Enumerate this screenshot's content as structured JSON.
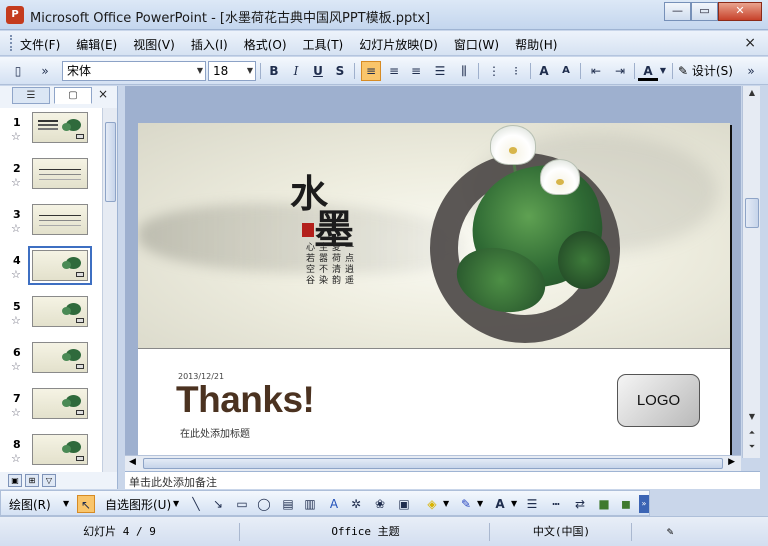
{
  "window": {
    "app_icon": "P",
    "title": "Microsoft Office PowerPoint - [水墨荷花古典中国风PPT模板.pptx]",
    "minimize": "—",
    "restore": "▭",
    "close": "✕"
  },
  "menu": {
    "items": [
      "文件(F)",
      "编辑(E)",
      "视图(V)",
      "插入(I)",
      "格式(O)",
      "工具(T)",
      "幻灯片放映(D)",
      "窗口(W)",
      "帮助(H)"
    ],
    "close": "×"
  },
  "toolbar": {
    "font_name": "宋体",
    "font_size": "18",
    "bold": "B",
    "italic": "I",
    "underline": "U",
    "shadow": "S",
    "design_label": "设计(S)"
  },
  "left_pane": {
    "close": "×",
    "slides": [
      {
        "number": "1"
      },
      {
        "number": "2"
      },
      {
        "number": "3"
      },
      {
        "number": "4"
      },
      {
        "number": "5"
      },
      {
        "number": "6"
      },
      {
        "number": "7"
      },
      {
        "number": "8"
      }
    ],
    "selected_index": 4
  },
  "slide": {
    "title_calligraphy_1": "水",
    "title_calligraphy_2": "墨",
    "poem_cols": [
      "心若空谷",
      "尘嚣不染",
      "夏荷清韵",
      "一点逍遥"
    ],
    "date": "2013/12/21",
    "thanks": "Thanks!",
    "subtitle": "在此处添加标题",
    "logo": "LOGO"
  },
  "notes_placeholder": "单击此处添加备注",
  "drawbar": {
    "draw_label": "绘图(R)",
    "autoshapes_label": "自选图形(U)"
  },
  "status": {
    "slide_position": "幻灯片 4 / 9",
    "theme": "Office 主题",
    "language": "中文(中国)"
  }
}
